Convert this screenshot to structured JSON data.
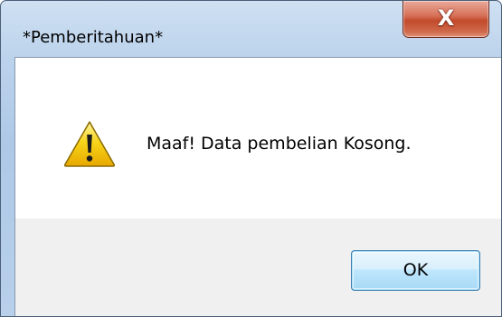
{
  "dialog": {
    "title": "*Pemberitahuan*",
    "message": "Maaf! Data pembelian Kosong.",
    "icon": "warning-icon",
    "ok_label": "OK",
    "close_glyph": "X"
  },
  "colors": {
    "close_button": "#c24a2c",
    "ok_button_border": "#3c7fb1",
    "warning_fill": "#f5c800"
  }
}
